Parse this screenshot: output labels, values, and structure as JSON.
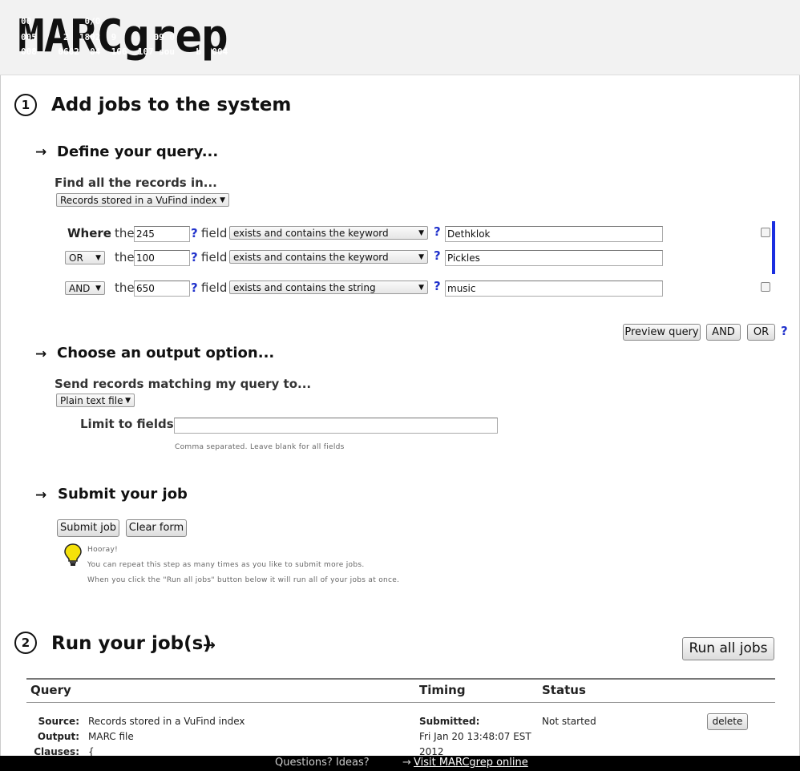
{
  "header": {
    "logo": "MARCgrep",
    "noise_lines": [
      "00          0/0",
      "005     2  1802  9       09 0",
      "008    0602  04  106  107 sou    b  004"
    ]
  },
  "step1": {
    "number": "1",
    "title": "Add jobs to the system",
    "define": {
      "arrow": "→",
      "heading": "Define your query...",
      "find_label": "Find all the records in...",
      "source_select": "Records stored in a VuFind index",
      "rows": [
        {
          "connector": "Where",
          "the": "the",
          "field_value": "245",
          "help": "?",
          "field_label": "field",
          "operator": "exists and contains the keyword",
          "value": "Dethklok"
        },
        {
          "connector": "OR",
          "the": "the",
          "field_value": "100",
          "help": "?",
          "field_label": "field",
          "operator": "exists and contains the keyword",
          "value": "Pickles"
        },
        {
          "connector": "AND",
          "the": "the",
          "field_value": "650",
          "help": "?",
          "field_label": "field",
          "operator": "exists and contains the string",
          "value": "music"
        }
      ],
      "op_help": "?",
      "buttons": {
        "preview": "Preview query",
        "and": "AND",
        "or": "OR",
        "help": "?"
      }
    },
    "output": {
      "arrow": "→",
      "heading": "Choose an output option...",
      "send_label": "Send records matching my query to...",
      "output_select": "Plain text file",
      "limit_label": "Limit to fields",
      "limit_value": "",
      "hint": "Comma separated. Leave blank for all fields"
    },
    "submit": {
      "arrow": "→",
      "heading": "Submit your job",
      "submit_button": "Submit job",
      "clear_button": "Clear form",
      "tip_title": "Hooray!",
      "tip_line1": "You can repeat this step as many times as you like to submit more jobs.",
      "tip_line2": "When you click the \"Run all jobs\" button below it will run all of your jobs at once."
    }
  },
  "step2": {
    "number": "2",
    "title": "Run your job(s)",
    "arrow": "→",
    "run_button": "Run all jobs",
    "table": {
      "headers": [
        "Query",
        "Timing",
        "Status"
      ],
      "row": {
        "source_label": "Source:",
        "source": "Records stored in a VuFind index",
        "output_label": "Output:",
        "output": "MARC file",
        "clauses_label": "Clauses:",
        "clauses": "{",
        "submitted_label": "Submitted:",
        "submitted_line1": "Fri Jan 20 13:48:07 EST",
        "submitted_line2": "2012",
        "status": "Not started",
        "delete": "delete"
      }
    }
  },
  "footer": {
    "questions": "Questions? Ideas?",
    "arrow": "→",
    "link": "Visit MARCgrep online"
  }
}
